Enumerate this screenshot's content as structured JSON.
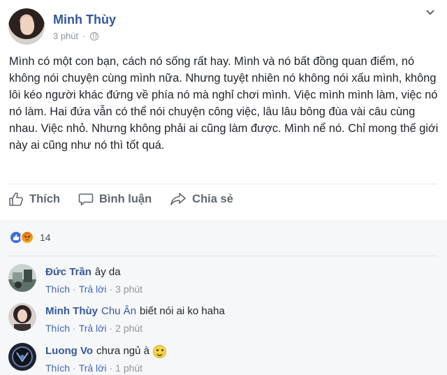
{
  "post": {
    "author": "Minh Thùy",
    "time": "3 phút",
    "text": "Mình có một con bạn, cách nó sống rất hay. Mình và nó bất đồng quan điểm, nó không nói chuyện cùng mình nữa. Nhưng tuyệt nhiên nó không nói xấu mình, không lôi kéo người khác đứng về phía nó mà nghỉ chơi mình. Việc mình mình làm, việc nó nó làm. Hai đứa vẫn có thể nói chuyện công việc, lâu lâu bông đùa vài câu cùng nhau. Việc nhỏ. Nhưng không phải ai cũng làm được. Mình nể nó. Chỉ mong thế giới này ai cũng như nó thì tốt quá.",
    "privacy_icon": "globe-icon",
    "menu_icon": "chevron-down-icon"
  },
  "actions": {
    "like": "Thích",
    "comment": "Bình luận",
    "share": "Chia sẻ"
  },
  "reactions": {
    "types": [
      "like",
      "angry"
    ],
    "count": "14"
  },
  "comments": [
    {
      "name": "Đức Trần",
      "text": "ây da",
      "like": "Thích",
      "reply": "Trả lời",
      "time": "3 phút"
    },
    {
      "name": "Minh Thùy",
      "tag": "Chu Ân",
      "text": "biết nói ai ko haha",
      "like": "Thích",
      "reply": "Trả lời",
      "time": "2 phút"
    },
    {
      "name": "Luong Vo",
      "text": "chưa ngủ à",
      "emoji": "smile",
      "like": "Thích",
      "reply": "Trả lời",
      "time": "1 phút"
    }
  ],
  "colors": {
    "name": "#365899",
    "muted": "#90949c",
    "action": "#606770",
    "link": "#4267b2"
  },
  "footer_separator": "·"
}
